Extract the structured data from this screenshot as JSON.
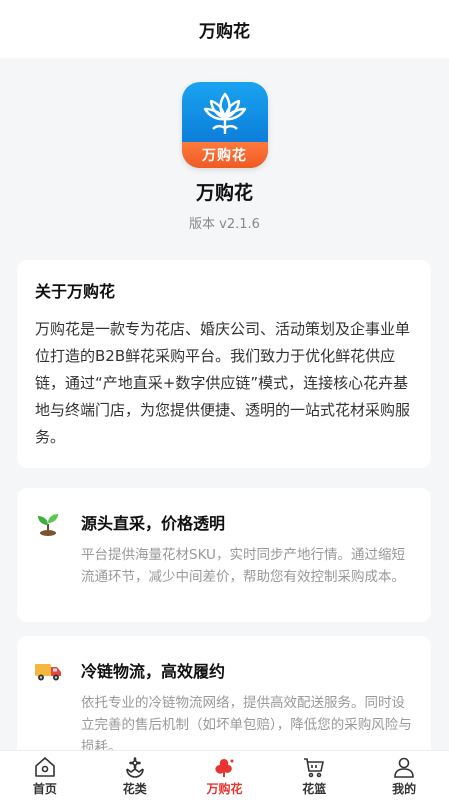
{
  "navbar": {
    "title": "万购花"
  },
  "header": {
    "logo_text": "万购花",
    "app_name": "万购花",
    "version": "版本 v2.1.6"
  },
  "about": {
    "title": "关于万购花",
    "text": "万购花是一款专为花店、婚庆公司、活动策划及企事业单位打造的B2B鲜花采购平台。我们致力于优化鲜花供应链，通过“产地直采+数字供应链”模式，连接核心花卉基地与终端门店，为您提供便捷、透明的一站式花材采购服务。"
  },
  "features": [
    {
      "icon": "seedling-icon",
      "title": "源头直采，价格透明",
      "text": "平台提供海量花材SKU，实时同步产地行情。通过缩短流通环节，减少中间差价，帮助您有效控制采购成本。"
    },
    {
      "icon": "delivery-truck-icon",
      "title": "冷链物流，高效履约",
      "text": "依托专业的冷链物流网络，提供高效配送服务。同时设立完善的售后机制（如坏单包赔），降低您的采购风险与损耗。"
    }
  ],
  "tabbar": {
    "items": [
      {
        "label": "首页",
        "icon": "home-icon"
      },
      {
        "label": "花类",
        "icon": "flower-category-icon"
      },
      {
        "label": "万购花",
        "icon": "brand-flower-icon",
        "active": true
      },
      {
        "label": "花篮",
        "icon": "cart-icon"
      },
      {
        "label": "我的",
        "icon": "user-icon"
      }
    ]
  },
  "colors": {
    "accent": "#e6352f",
    "brand_blue": "#0f86df",
    "brand_orange": "#f05a22"
  }
}
